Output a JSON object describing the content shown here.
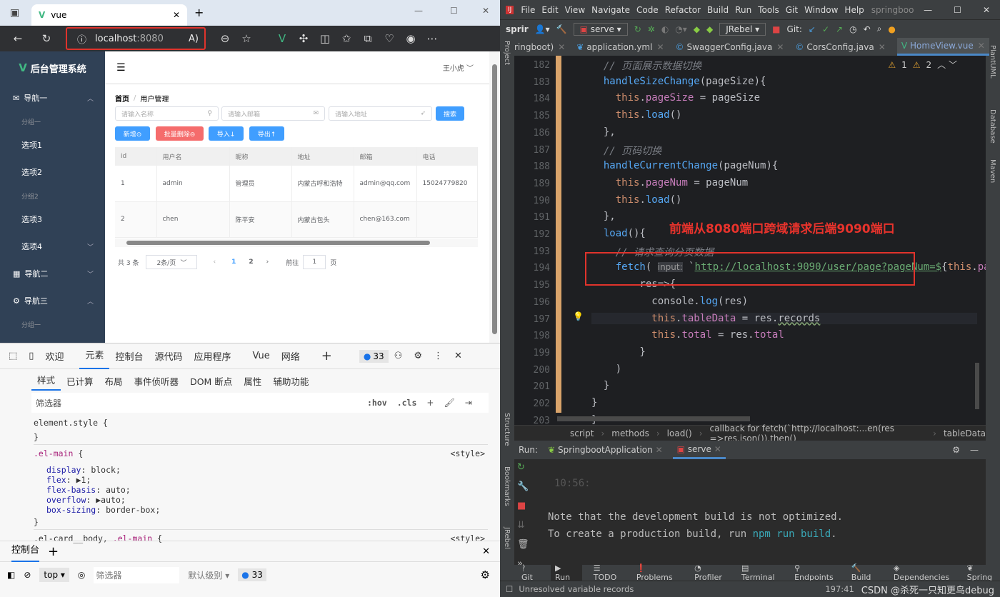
{
  "browser": {
    "tab_title": "vue",
    "address": "localhost",
    "address_port": ":8080",
    "app": {
      "logo": "后台管理系统",
      "user": "王小虎",
      "sidebar": {
        "nav1": "导航一",
        "group1": "分组一",
        "opt1": "选项1",
        "opt2": "选项2",
        "group2": "分组2",
        "opt3": "选项3",
        "opt4": "选项4",
        "nav2": "导航二",
        "nav3": "导航三",
        "group3": "分组一",
        "opt5": "选项1"
      },
      "breadcrumb": [
        "首页",
        "用户管理"
      ],
      "search": {
        "name_placeholder": "请输入名称",
        "email_placeholder": "请输入邮箱",
        "address_placeholder": "请输入地址",
        "button": "搜索"
      },
      "actions": {
        "add": "新增⊙",
        "batch_delete": "批量删除⊝",
        "import": "导入↓",
        "export": "导出↑"
      },
      "table": {
        "columns": [
          "id",
          "用户名",
          "昵称",
          "地址",
          "邮箱",
          "电话"
        ],
        "rows": [
          [
            "1",
            "admin",
            "管理员",
            "内蒙古呼和浩特",
            "admin@qq.com",
            "15024779820"
          ],
          [
            "2",
            "chen",
            "陈平安",
            "内蒙古包头",
            "chen@163.com",
            ""
          ]
        ]
      },
      "pagination": {
        "total": "共 3 条",
        "page_size": "2条/页",
        "pages": [
          "1",
          "2"
        ],
        "current": "1",
        "goto_label": "前往",
        "goto_value": "1",
        "goto_suffix": "页"
      }
    }
  },
  "devtools": {
    "tabs": [
      "欢迎",
      "元素",
      "控制台",
      "源代码",
      "应用程序",
      "Vue",
      "网络"
    ],
    "active_tab": "元素",
    "issues": "33",
    "subtabs": [
      "样式",
      "已计算",
      "布局",
      "事件侦听器",
      "DOM 断点",
      "属性",
      "辅助功能"
    ],
    "filter_placeholder": "筛选器",
    "hov": ":hov",
    "cls": ".cls",
    "rules": {
      "r1": "element.style {",
      "r1close": "}",
      "r2sel": ".el-main",
      "r2open": " {",
      "src": "<style>",
      "decls": [
        [
          "display",
          "block;"
        ],
        [
          "flex",
          "▶1;"
        ],
        [
          "flex-basis",
          "auto;"
        ],
        [
          "overflow",
          "▶auto;"
        ],
        [
          "box-sizing",
          "border-box;"
        ]
      ],
      "r2close": "}",
      "r3a": ".el-card__body, ",
      "r3b": ".el-main",
      "r3c": " {"
    },
    "console": {
      "tab": "控制台",
      "context": "top",
      "filter_placeholder": "筛选器",
      "level": "默认级别",
      "issues": "33"
    }
  },
  "ide": {
    "menu": [
      "File",
      "Edit",
      "View",
      "Navigate",
      "Code",
      "Refactor",
      "Build",
      "Run",
      "Tools",
      "Git",
      "Window",
      "Help"
    ],
    "project_title": "springboo",
    "toolbar": {
      "project": "sprir",
      "run_config": "serve",
      "jrebel": "JRebel",
      "git": "Git:"
    },
    "tabs": [
      "ringboot)",
      "application.yml",
      "SwaggerConfig.java",
      "CorsConfig.java",
      "HomeView.vue"
    ],
    "active_tab": "HomeView.vue",
    "warnings": "1",
    "weak_warnings": "2",
    "annotation": "前端从8080端口跨域请求后端9090端口",
    "code_lines": [
      "182",
      "183",
      "184",
      "185",
      "186",
      "187",
      "188",
      "189",
      "190",
      "191",
      "192",
      "193",
      "194",
      "195",
      "196",
      "197",
      "198",
      "199",
      "200",
      "201",
      "202",
      "203"
    ],
    "breadcrumb": [
      "script",
      "methods",
      "load()",
      "callback for fetch(`http://localhost:...en(res =>res.json()).then()",
      "tableData"
    ],
    "run": {
      "label": "Run:",
      "tabs": [
        "SpringbootApplication",
        "serve"
      ],
      "time": "10:56:",
      "line1": "Note that the development build is not optimized.",
      "line2a": "To create a production build, run ",
      "line2b": "npm run build",
      "line2c": "."
    },
    "bottom_tabs": [
      "Git",
      "Run",
      "TODO",
      "Problems",
      "Profiler",
      "Terminal",
      "Endpoints",
      "Build",
      "Dependencies",
      "Spring"
    ],
    "side_tools": [
      "Project",
      "Structure",
      "Bookmarks",
      "JRebel",
      "PlantUML",
      "Database",
      "Maven"
    ],
    "status": {
      "message": "Unresolved variable records",
      "position": "197:41",
      "watermark": "CSDN @杀死一只知更鸟debug"
    }
  }
}
